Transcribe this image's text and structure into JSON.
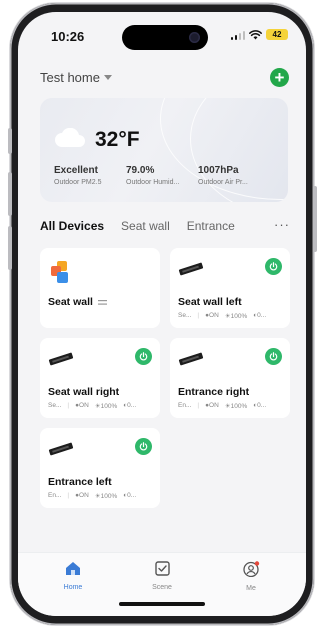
{
  "status": {
    "time": "10:26",
    "battery": "42"
  },
  "header": {
    "home_name": "Test home",
    "add_label": "+"
  },
  "weather": {
    "temperature": "32°F",
    "metrics": [
      {
        "value": "Excellent",
        "label": "Outdoor PM2.5"
      },
      {
        "value": "79.0%",
        "label": "Outdoor Humid..."
      },
      {
        "value": "1007hPa",
        "label": "Outdoor Air Pr..."
      }
    ]
  },
  "tabs": [
    {
      "label": "All Devices"
    },
    {
      "label": "Seat wall"
    },
    {
      "label": "Entrance"
    }
  ],
  "more_label": "···",
  "devices": [
    {
      "name": "Seat wall",
      "icon": "group-icon",
      "trailing_icon": "group-list-icon"
    },
    {
      "name": "Seat wall left",
      "icon": "wall-light-icon",
      "room": "Se...",
      "state": "ON",
      "brightness": "100%",
      "extra": "0..."
    },
    {
      "name": "Seat wall right",
      "icon": "wall-light-icon",
      "room": "Se...",
      "state": "ON",
      "brightness": "100%",
      "extra": "0..."
    },
    {
      "name": "Entrance right",
      "icon": "wall-light-icon",
      "room": "En...",
      "state": "ON",
      "brightness": "100%",
      "extra": "0..."
    },
    {
      "name": "Entrance left",
      "icon": "wall-light-icon",
      "room": "En...",
      "state": "ON",
      "brightness": "100%",
      "extra": "0..."
    }
  ],
  "tabbar": [
    {
      "label": "Home",
      "icon": "home-icon"
    },
    {
      "label": "Scene",
      "icon": "scene-icon"
    },
    {
      "label": "Me",
      "icon": "profile-icon"
    }
  ],
  "colors": {
    "accent": "#3a7bd5",
    "power_on": "#2fb86a",
    "add_button": "#22a74a"
  }
}
